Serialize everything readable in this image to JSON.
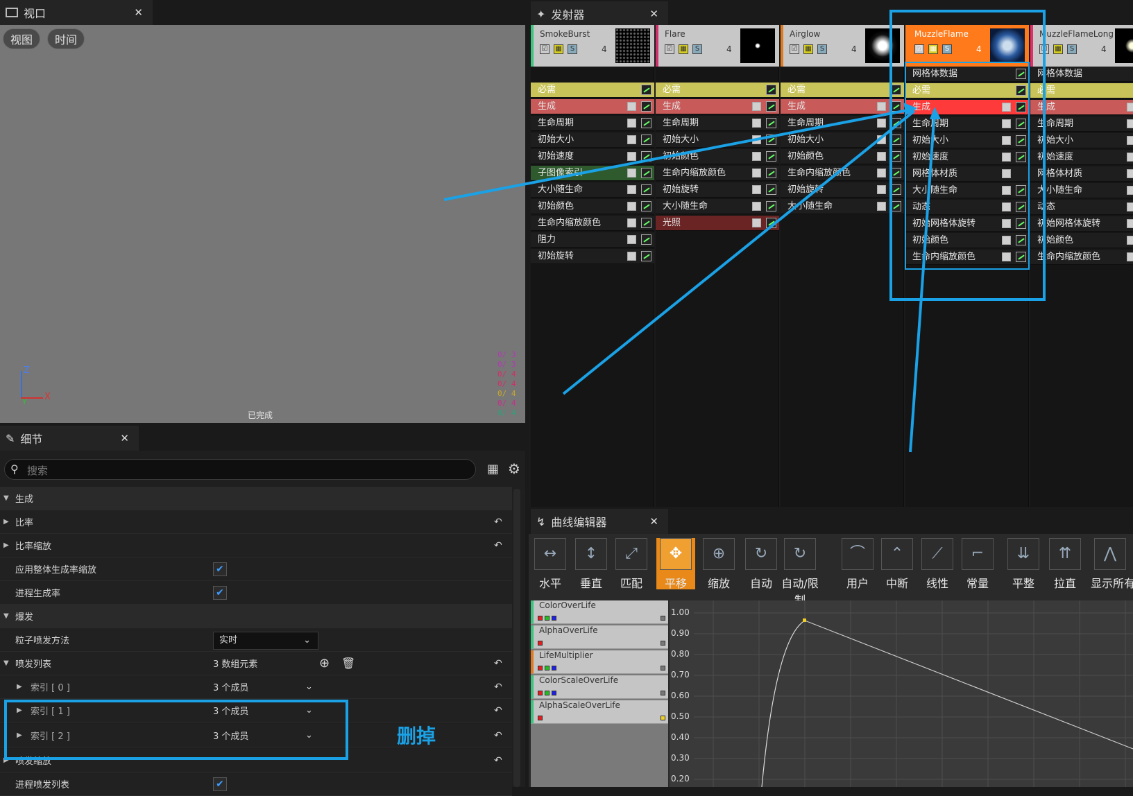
{
  "viewport": {
    "tab_title": "视口",
    "close": "✕",
    "btn_view": "视图",
    "btn_time": "时间",
    "status": "已完成",
    "axis_z": "Z",
    "axis_x": "X",
    "axis_y": "Y",
    "stats": [
      "0/ 3",
      "0/ 3",
      "0/ 4",
      "0/ 4",
      "0/ 4",
      "0/ 4",
      "0/ 4"
    ],
    "stat_colors": [
      "#b03bb0",
      "#b03bb0",
      "#d0306a",
      "#d0306a",
      "#c8a82e",
      "#c8308a",
      "#2fa07a"
    ]
  },
  "emitters": {
    "tab_title": "发射器",
    "close": "✕",
    "columns": [
      {
        "name": "SmokeBurst",
        "count": "4",
        "accent": "#3ac47d",
        "modules": [
          "必需",
          "生成",
          "生命周期",
          "初始大小",
          "初始速度",
          "子图像索引",
          "大小随生命",
          "初始颜色",
          "生命内缩放颜色",
          "阻力",
          "初始旋转"
        ]
      },
      {
        "name": "Flare",
        "count": "4",
        "accent": "#d0306a",
        "modules": [
          "必需",
          "生成",
          "生命周期",
          "初始大小",
          "初始颜色",
          "生命内缩放颜色",
          "初始旋转",
          "大小随生命",
          "光照"
        ]
      },
      {
        "name": "Airglow",
        "count": "4",
        "accent": "#e07a20",
        "modules": [
          "必需",
          "生成",
          "生命周期",
          "初始大小",
          "初始颜色",
          "生命内缩放颜色",
          "初始旋转",
          "大小随生命"
        ]
      },
      {
        "name": "MuzzleFlame",
        "count": "4",
        "accent": "#ff7a1a",
        "modules": [
          "网格体数据",
          "必需",
          "生成",
          "生命周期",
          "初始大小",
          "初始速度",
          "网格体材质",
          "大小随生命",
          "动态",
          "初始网格体旋转",
          "初始颜色",
          "生命内缩放颜色"
        ]
      },
      {
        "name": "MuzzleFlameLong",
        "count": "4",
        "accent": "#e0306a",
        "modules": [
          "网格体数据",
          "必需",
          "生成",
          "生命周期",
          "初始大小",
          "初始速度",
          "网格体材质",
          "大小随生命",
          "动态",
          "初始网格体旋转",
          "初始颜色",
          "生命内缩放颜色"
        ]
      }
    ]
  },
  "details": {
    "tab_title": "细节",
    "close": "✕",
    "search_placeholder": "搜索",
    "sec_spawn": "生成",
    "rate": "比率",
    "rate_scale": "比率缩放",
    "apply_global": "应用整体生成率缩放",
    "process_rate": "进程生成率",
    "sec_burst": "爆发",
    "burst_method": "粒子喷发方法",
    "burst_method_val": "实时",
    "burst_list": "喷发列表",
    "burst_list_val": "3 数组元素",
    "idx0": "索引 [ 0 ]",
    "idx1": "索引 [ 1 ]",
    "idx2": "索引 [ 2 ]",
    "members": "3 个成员",
    "burst_scale": "喷发缩放",
    "process_burst": "进程喷发列表",
    "annotation": "删掉"
  },
  "curve_editor": {
    "tab_title": "曲线编辑器",
    "close": "✕",
    "tools": [
      "水平",
      "垂直",
      "匹配",
      "平移",
      "缩放",
      "自动",
      "自动/限制",
      "用户",
      "中断",
      "线性",
      "常量",
      "平整",
      "拉直",
      "显示所有"
    ],
    "curves": [
      {
        "name": "ColorOverLife",
        "accent": "#3ac47d",
        "swatches": [
          "#e02020",
          "#20c020",
          "#2020e0"
        ]
      },
      {
        "name": "AlphaOverLife",
        "accent": "#3ac47d",
        "swatches": [
          "#e02020"
        ]
      },
      {
        "name": "LifeMultiplier",
        "accent": "#e07a20",
        "swatches": [
          "#e02020",
          "#20c020",
          "#2020e0"
        ]
      },
      {
        "name": "ColorScaleOverLife",
        "accent": "#3ac47d",
        "swatches": [
          "#e02020",
          "#20c020",
          "#2020e0"
        ]
      },
      {
        "name": "AlphaScaleOverLife",
        "accent": "#3ac47d",
        "swatches": [
          "#e02020"
        ]
      }
    ],
    "y_ticks": [
      "1.00",
      "0.90",
      "0.80",
      "0.70",
      "0.60",
      "0.50",
      "0.40",
      "0.30",
      "0.20"
    ]
  }
}
